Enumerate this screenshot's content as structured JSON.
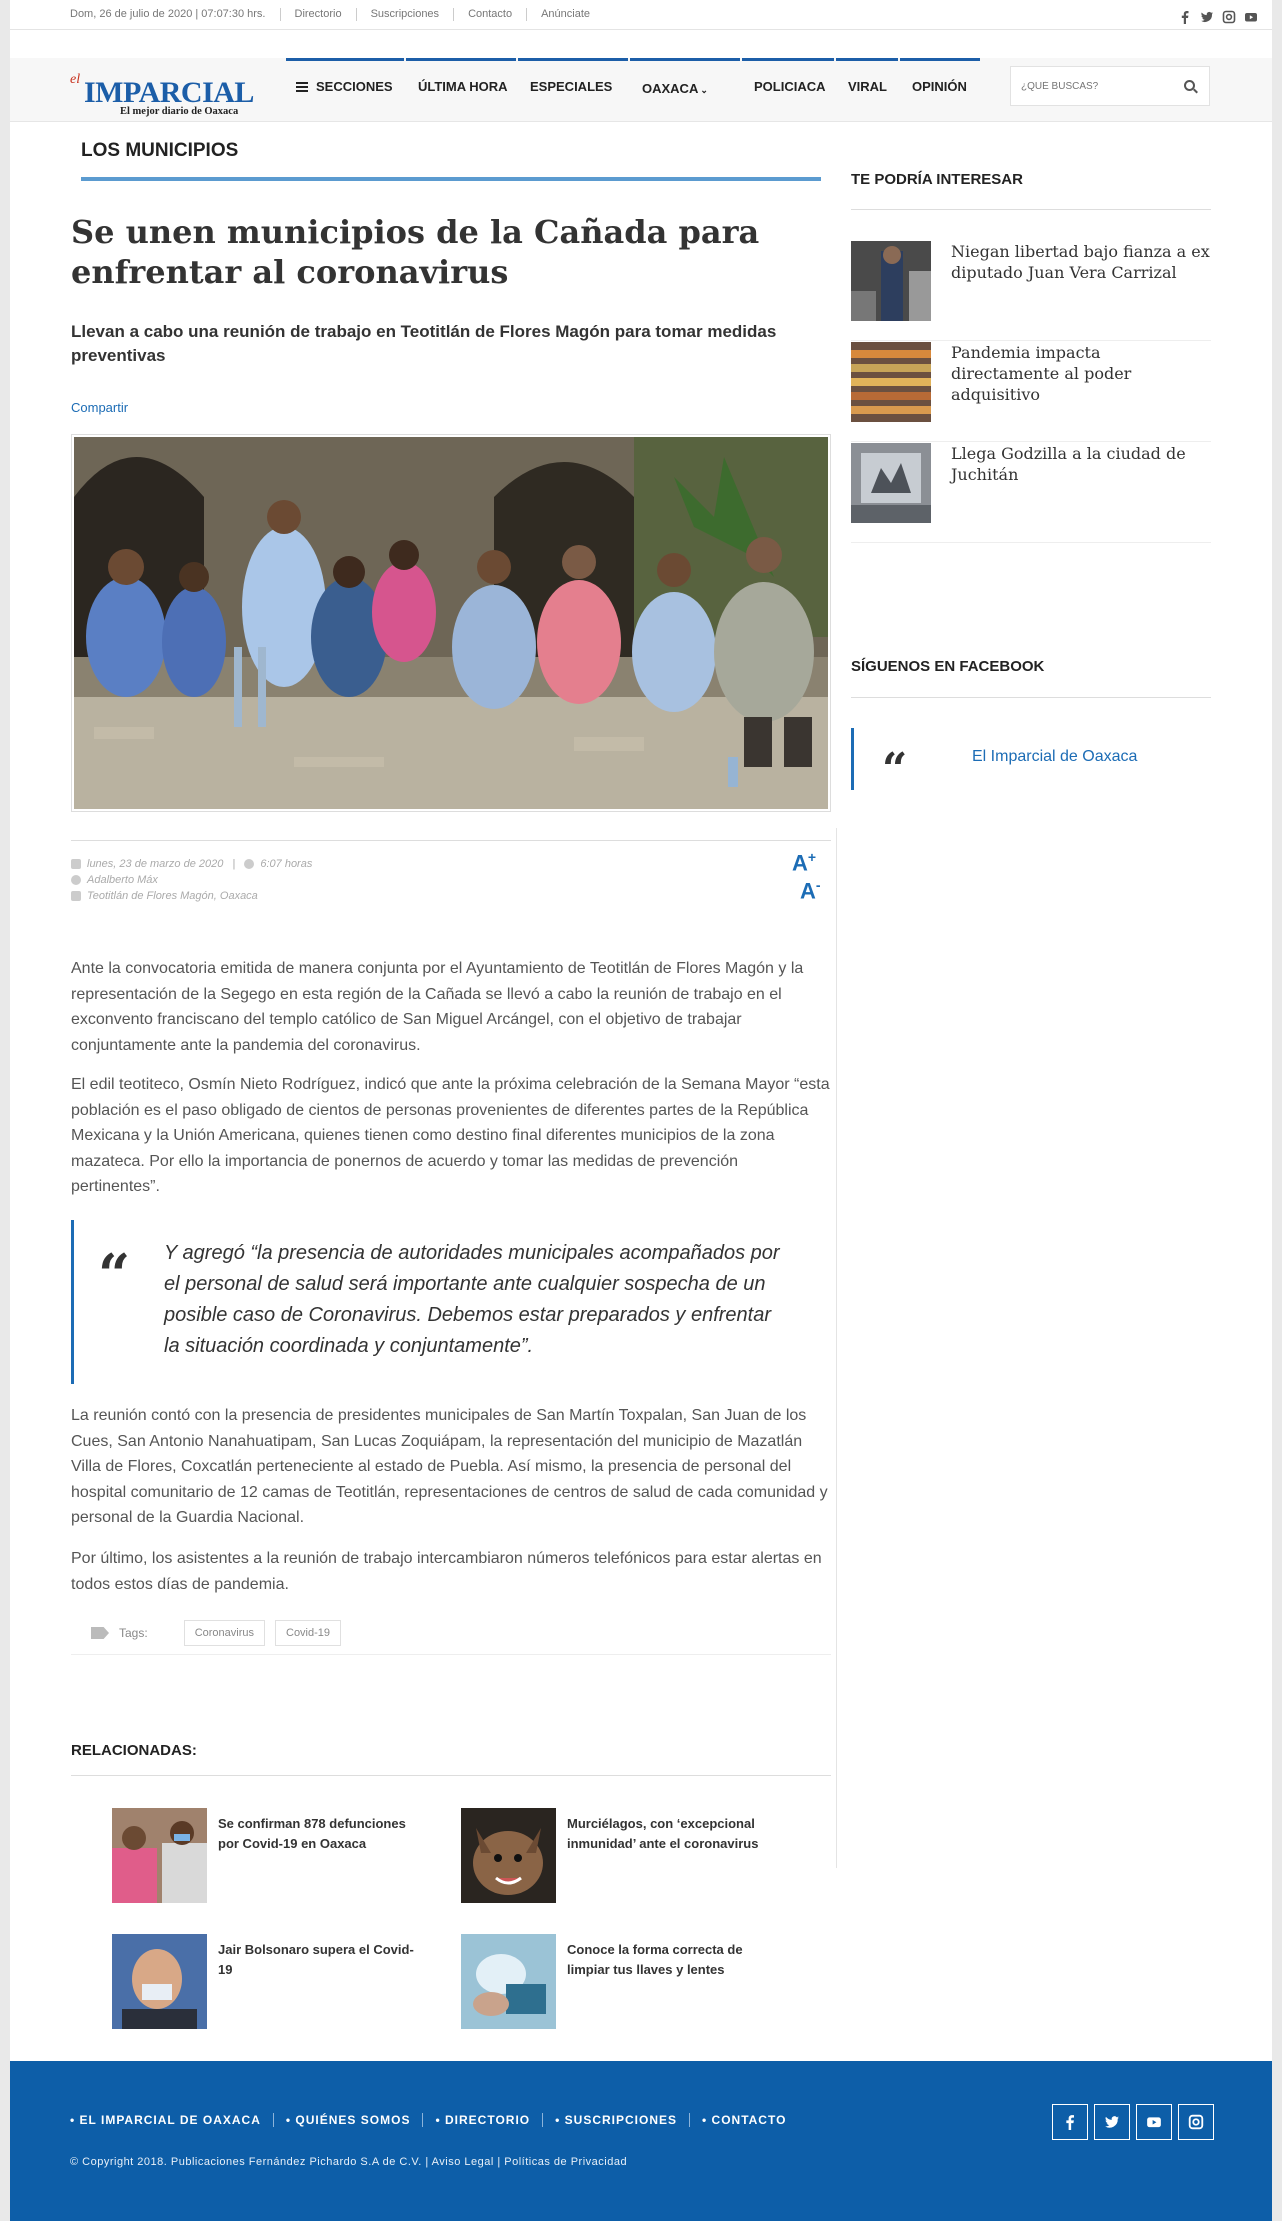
{
  "topbar": {
    "date": "Dom, 26 de julio de 2020 | 07:07:30 hrs.",
    "links": [
      "Directorio",
      "Suscripciones",
      "Contacto",
      "Anúnciate"
    ]
  },
  "logo": {
    "el": "el",
    "name": "IMPARCIAL",
    "tagline": "El mejor diario de Oaxaca"
  },
  "nav": {
    "sections": "SECCIONES",
    "items": [
      "ÚLTIMA HORA",
      "ESPECIALES",
      "OAXACA",
      "POLICIACA",
      "VIRAL",
      "OPINIÓN"
    ]
  },
  "search": {
    "placeholder": "¿QUÉ BUSCAS?"
  },
  "article": {
    "section": "LOS MUNICIPIOS",
    "title": "Se unen municipios de la Cañada para enfrentar al coronavirus",
    "subtitle": "Llevan a cabo una reunión de trabajo en Teotitlán de Flores Magón para tomar medidas preventivas",
    "share": "Compartir",
    "date": "lunes, 23 de marzo de 2020",
    "time": "6:07 horas",
    "author": "Adalberto Máx",
    "location": "Teotitlán de Flores Magón, Oaxaca",
    "font_up": "A",
    "font_down": "A",
    "p1": "Ante la convocatoria emitida de manera conjunta por el Ayuntamiento de Teotitlán de Flores Magón y la representación de la Segego en esta región de la Cañada se llevó a cabo la reunión de trabajo en el exconvento franciscano del templo católico de San Miguel Arcángel, con el objetivo de trabajar conjuntamente ante la pandemia del coronavirus.",
    "p2": "El edil teotiteco, Osmín Nieto Rodríguez, indicó que ante la próxima celebración de la Semana Mayor “esta población es el paso obligado de cientos de personas provenientes de diferentes partes de la República Mexicana y la Unión Americana, quienes tienen como destino final diferentes municipios de la zona mazateca. Por ello la importancia de ponernos de acuerdo y tomar las medidas de prevención pertinentes”.",
    "quote": "Y agregó “la presencia de autoridades municipales acompañados por el personal de salud será importante ante cualquier sospecha de un posible caso de Coronavirus. Debemos estar preparados y enfrentar la situación coordinada y conjuntamente”.",
    "p3": "La reunión contó con la presencia de presidentes municipales de San Martín Toxpalan, San Juan de los Cues, San Antonio Nanahuatipam, San Lucas Zoquiápam, la representación del municipio de Mazatlán Villa de Flores, Coxcatlán perteneciente al estado de Puebla. Así mismo, la presencia de personal del hospital comunitario de 12 camas de Teotitlán, representaciones de centros de salud de cada comunidad y personal de la Guardia Nacional.",
    "p4": "Por último, los asistentes a la reunión de trabajo intercambiaron números telefónicos para estar alertas en todos estos días de pandemia.",
    "tags_label": "Tags:",
    "tags": [
      "Coronavirus",
      "Covid-19"
    ]
  },
  "related": {
    "title": "RELACIONADAS:",
    "items": [
      "Se confirman 878 defunciones por Covid-19 en Oaxaca",
      "Murciélagos, con ‘excepcional inmunidad’ ante el coronavirus",
      "Jair Bolsonaro supera el Covid-19",
      "Conoce la forma correcta de limpiar tus llaves y lentes"
    ]
  },
  "sidebar": {
    "interest_title": "TE PODRÍA INTERESAR",
    "items": [
      "Niegan libertad bajo fianza a ex diputado Juan Vera Carrizal",
      "Pandemia impacta directamente al poder adquisitivo",
      "Llega Godzilla a la ciudad de Juchitán"
    ],
    "facebook_title": "SÍGUENOS EN FACEBOOK",
    "facebook_link": "El Imparcial de Oaxaca"
  },
  "footer": {
    "links": [
      "• EL IMPARCIAL DE OAXACA",
      "• QUIÉNES SOMOS",
      "• DIRECTORIO",
      "• SUSCRIPCIONES",
      "• CONTACTO"
    ],
    "copyright": "© Copyright 2018. Publicaciones Fernández Pichardo S.A de C.V. | Aviso Legal | Políticas de Privacidad"
  },
  "colors": {
    "accent": "#1c6cb5",
    "footer": "#0d5ea8",
    "section_line": "#5b9bd0"
  },
  "icons": [
    "facebook-icon",
    "twitter-icon",
    "instagram-icon",
    "youtube-icon",
    "menu-icon",
    "search-icon",
    "calendar-icon",
    "clock-icon",
    "user-icon",
    "location-icon",
    "tag-icon",
    "quote-icon"
  ]
}
